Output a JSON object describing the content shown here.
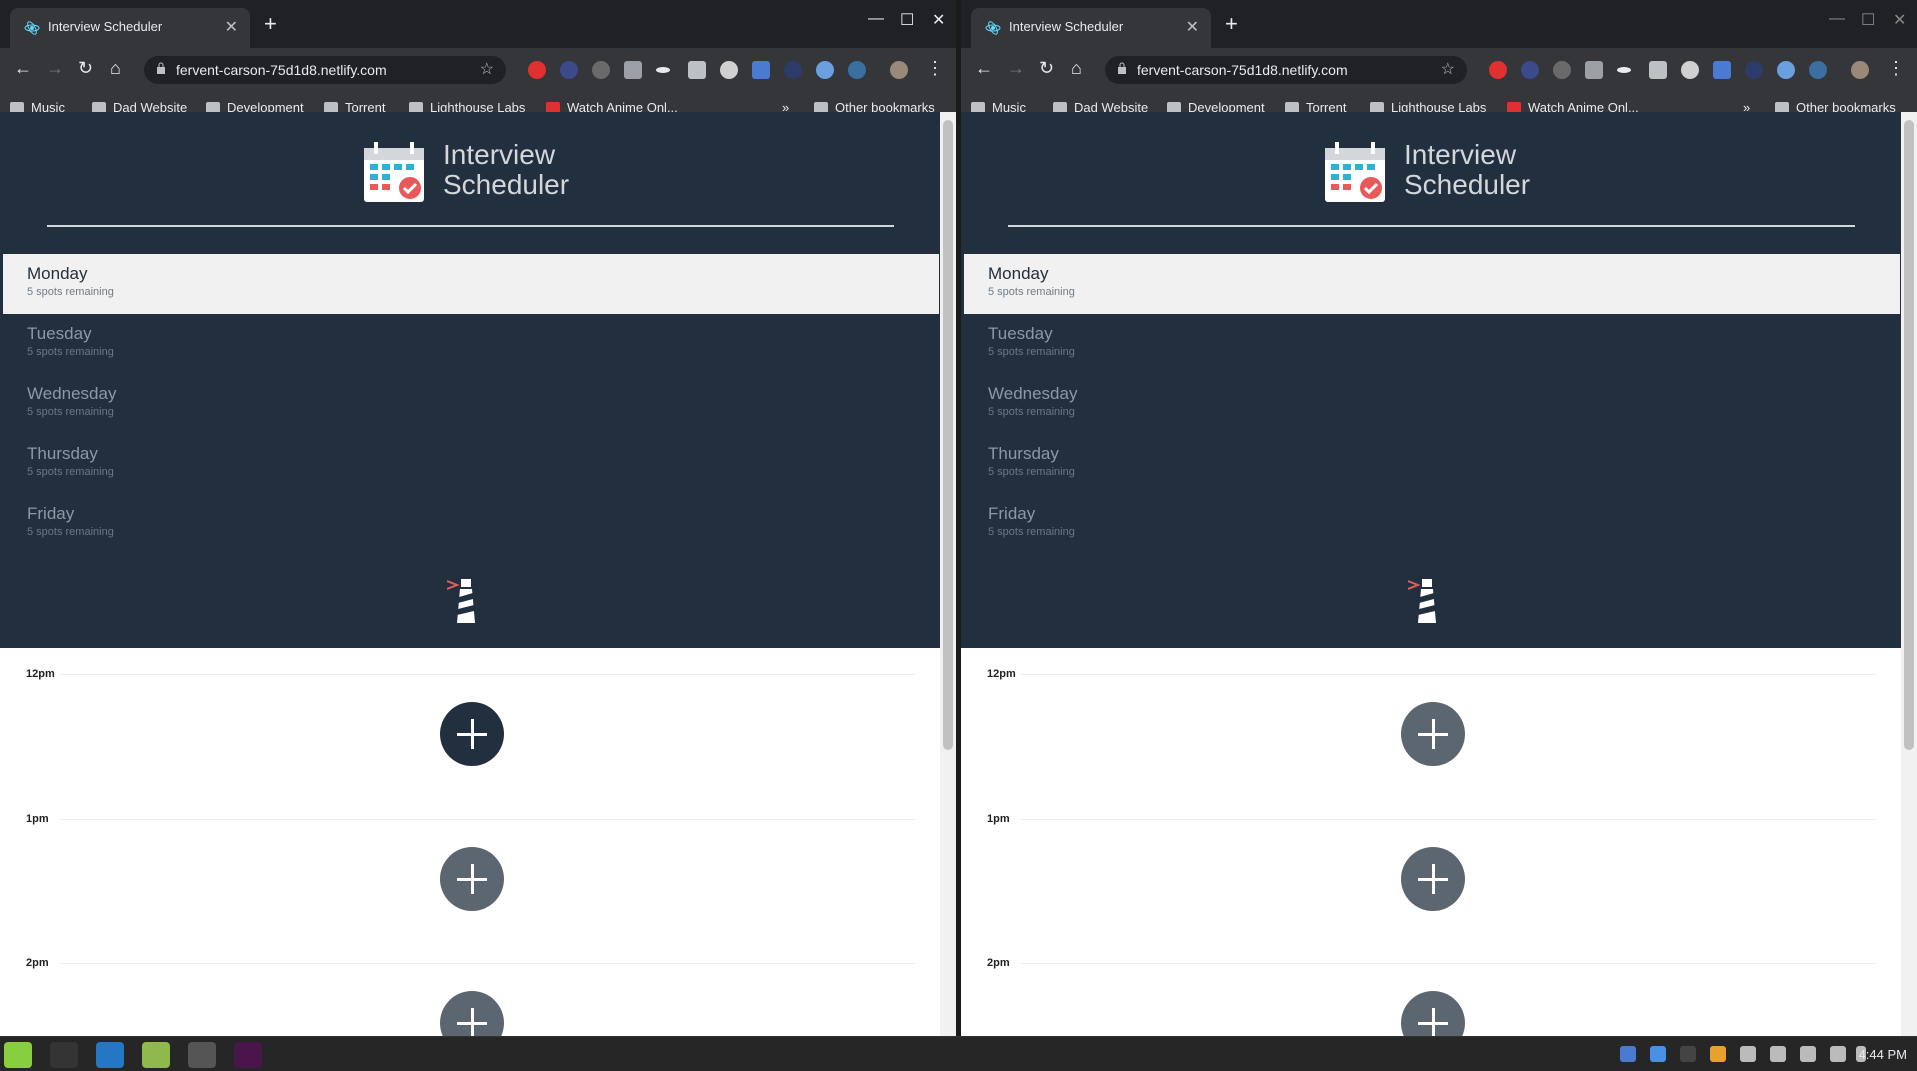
{
  "tab": {
    "title": "Interview Scheduler"
  },
  "url": "fervent-carson-75d1d8.netlify.com",
  "bookmarks": [
    "Music",
    "Dad Website",
    "Development",
    "Torrent",
    "Lighthouse Labs",
    "Watch Anime Onl...",
    "Other bookmarks"
  ],
  "app": {
    "title_line1": "Interview",
    "title_line2": "Scheduler"
  },
  "days": [
    {
      "name": "Monday",
      "spots": "5 spots remaining"
    },
    {
      "name": "Tuesday",
      "spots": "5 spots remaining"
    },
    {
      "name": "Wednesday",
      "spots": "5 spots remaining"
    },
    {
      "name": "Thursday",
      "spots": "5 spots remaining"
    },
    {
      "name": "Friday",
      "spots": "5 spots remaining"
    }
  ],
  "times": [
    "12pm",
    "1pm",
    "2pm"
  ],
  "clock": "4:44 PM",
  "colors": {
    "nav": "#222f3e",
    "selected": "#f1f1f1",
    "add_button": "#5c6670"
  }
}
